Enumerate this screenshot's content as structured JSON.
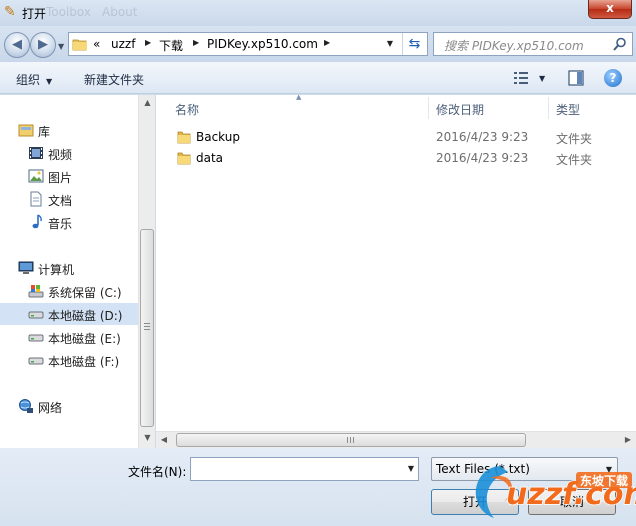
{
  "window": {
    "title": "打开",
    "ghost_menu": [
      "Toolbox",
      "About"
    ],
    "close_label": "x"
  },
  "nav": {
    "back_icon": "back-arrow-icon",
    "forward_icon": "forward-arrow-icon"
  },
  "address": {
    "overflow": "«",
    "crumbs": [
      "uzzf",
      "下载",
      "PIDKey.xp510.com"
    ]
  },
  "search": {
    "placeholder": "搜索 PIDKey.xp510.com"
  },
  "toolbar": {
    "organize": "组织",
    "new_folder": "新建文件夹"
  },
  "sidebar": {
    "items": [
      {
        "label": "库",
        "icon": "library-icon"
      },
      {
        "label": "视频",
        "icon": "video-icon"
      },
      {
        "label": "图片",
        "icon": "picture-icon"
      },
      {
        "label": "文档",
        "icon": "document-icon"
      },
      {
        "label": "音乐",
        "icon": "music-icon"
      },
      {
        "label": "计算机",
        "icon": "computer-icon"
      },
      {
        "label": "系统保留 (C:)",
        "icon": "system-drive-icon"
      },
      {
        "label": "本地磁盘 (D:)",
        "icon": "drive-icon"
      },
      {
        "label": "本地磁盘 (E:)",
        "icon": "drive-icon"
      },
      {
        "label": "本地磁盘 (F:)",
        "icon": "drive-icon"
      },
      {
        "label": "网络",
        "icon": "network-icon"
      }
    ],
    "selected": "本地磁盘 (D:)"
  },
  "filelist": {
    "columns": [
      "名称",
      "修改日期",
      "类型"
    ],
    "rows": [
      {
        "name": "Backup",
        "date": "2016/4/23 9:23",
        "type": "文件夹"
      },
      {
        "name": "data",
        "date": "2016/4/23 9:23",
        "type": "文件夹"
      }
    ]
  },
  "bottom": {
    "filename_label": "文件名(N):",
    "filename_value": "",
    "filetype": "Text Files (*.txt)",
    "open_label": "打开",
    "cancel_label": "取消"
  },
  "watermark": {
    "brand": "uzzf.com",
    "tag": "东坡下载"
  },
  "colors": {
    "frame": "#cfdbe8",
    "selection": "#d3e2f4",
    "close": "#c7432b",
    "watermark_orange": "#f26b1d",
    "watermark_blue": "#1b8fd8"
  }
}
